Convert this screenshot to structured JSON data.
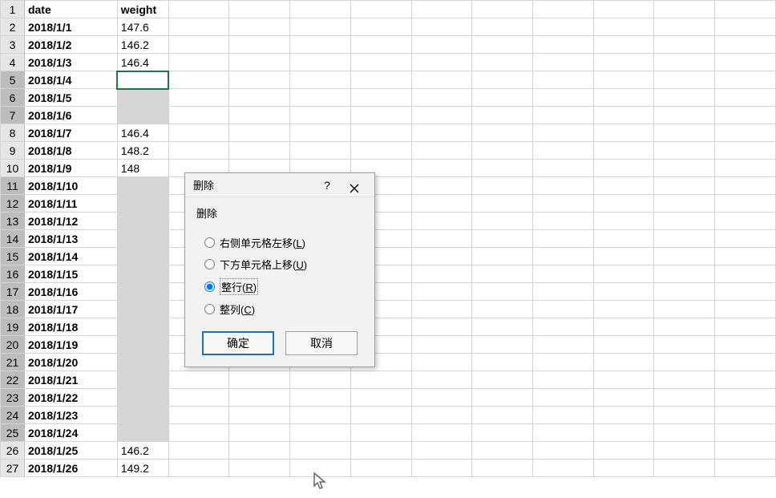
{
  "headers": {
    "colA": "date",
    "colB": "weight"
  },
  "rows": [
    {
      "n": 1,
      "date": "date",
      "weight": "weight",
      "header": true
    },
    {
      "n": 2,
      "date": "2018/1/1",
      "weight": "147.6"
    },
    {
      "n": 3,
      "date": "2018/1/2",
      "weight": "146.2"
    },
    {
      "n": 4,
      "date": "2018/1/3",
      "weight": "146.4"
    },
    {
      "n": 5,
      "date": "2018/1/4",
      "weight": "",
      "selected": true,
      "active": true
    },
    {
      "n": 6,
      "date": "2018/1/5",
      "weight": "",
      "selected": true
    },
    {
      "n": 7,
      "date": "2018/1/6",
      "weight": "",
      "selected": true
    },
    {
      "n": 8,
      "date": "2018/1/7",
      "weight": "146.4"
    },
    {
      "n": 9,
      "date": "2018/1/8",
      "weight": "148.2"
    },
    {
      "n": 10,
      "date": "2018/1/9",
      "weight": "148"
    },
    {
      "n": 11,
      "date": "2018/1/10",
      "weight": "",
      "selected": true
    },
    {
      "n": 12,
      "date": "2018/1/11",
      "weight": "",
      "selected": true
    },
    {
      "n": 13,
      "date": "2018/1/12",
      "weight": "",
      "selected": true
    },
    {
      "n": 14,
      "date": "2018/1/13",
      "weight": "",
      "selected": true
    },
    {
      "n": 15,
      "date": "2018/1/14",
      "weight": "",
      "selected": true
    },
    {
      "n": 16,
      "date": "2018/1/15",
      "weight": "",
      "selected": true
    },
    {
      "n": 17,
      "date": "2018/1/16",
      "weight": "",
      "selected": true
    },
    {
      "n": 18,
      "date": "2018/1/17",
      "weight": "",
      "selected": true
    },
    {
      "n": 19,
      "date": "2018/1/18",
      "weight": "",
      "selected": true
    },
    {
      "n": 20,
      "date": "2018/1/19",
      "weight": "",
      "selected": true
    },
    {
      "n": 21,
      "date": "2018/1/20",
      "weight": "",
      "selected": true
    },
    {
      "n": 22,
      "date": "2018/1/21",
      "weight": "",
      "selected": true
    },
    {
      "n": 23,
      "date": "2018/1/22",
      "weight": "",
      "selected": true
    },
    {
      "n": 24,
      "date": "2018/1/23",
      "weight": "",
      "selected": true
    },
    {
      "n": 25,
      "date": "2018/1/24",
      "weight": "",
      "selected": true
    },
    {
      "n": 26,
      "date": "2018/1/25",
      "weight": "146.2"
    },
    {
      "n": 27,
      "date": "2018/1/26",
      "weight": "149.2"
    }
  ],
  "blankCols": 10,
  "dialog": {
    "title": "删除",
    "help": "?",
    "section": "删除",
    "options": {
      "shiftLeft": {
        "text": "右侧单元格左移(",
        "mn": "L",
        "suffix": ")"
      },
      "shiftUp": {
        "text": "下方单元格上移(",
        "mn": "U",
        "suffix": ")"
      },
      "entireRow": {
        "text": "整行(",
        "mn": "R",
        "suffix": ")"
      },
      "entireCol": {
        "text": "整列(",
        "mn": "C",
        "suffix": ")"
      }
    },
    "selected": "entireRow",
    "ok": "确定",
    "cancel": "取消"
  }
}
